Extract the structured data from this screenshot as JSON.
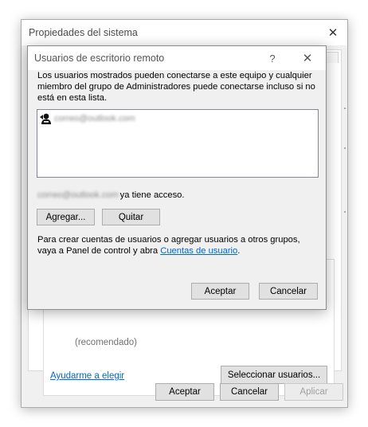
{
  "outer_window": {
    "title": "Propiedades del sistema",
    "close_glyph": "✕",
    "recommended_text": "(recomendado)",
    "help_link": "Ayudarme a elegir",
    "select_users_button": "Seleccionar usuarios...",
    "ok_button": "Aceptar",
    "cancel_button": "Cancelar",
    "apply_button": "Aplicar"
  },
  "dialog": {
    "title": "Usuarios de escritorio remoto",
    "help_glyph": "?",
    "close_glyph": "✕",
    "description": "Los usuarios mostrados pueden conectarse a este equipo y cualquier miembro del grupo de Administradores puede conectarse incluso si no está en esta lista.",
    "users": [
      {
        "email": "correo@outlook.com",
        "icon": "user-icon"
      }
    ],
    "access_email": "correo@outlook.com",
    "access_suffix": "ya tiene acceso.",
    "add_button": "Agregar...",
    "remove_button": "Quitar",
    "info_prefix": "Para crear cuentas de usuarios o agregar usuarios a otros grupos, vaya a Panel de control y abra ",
    "info_link": "Cuentas de usuario",
    "info_suffix": ".",
    "ok_button": "Aceptar",
    "cancel_button": "Cancelar"
  },
  "colors": {
    "link": "#0066cc",
    "window_bg": "#f0f0f0",
    "button_bg": "#e1e1e1",
    "button_border": "#adadad"
  }
}
